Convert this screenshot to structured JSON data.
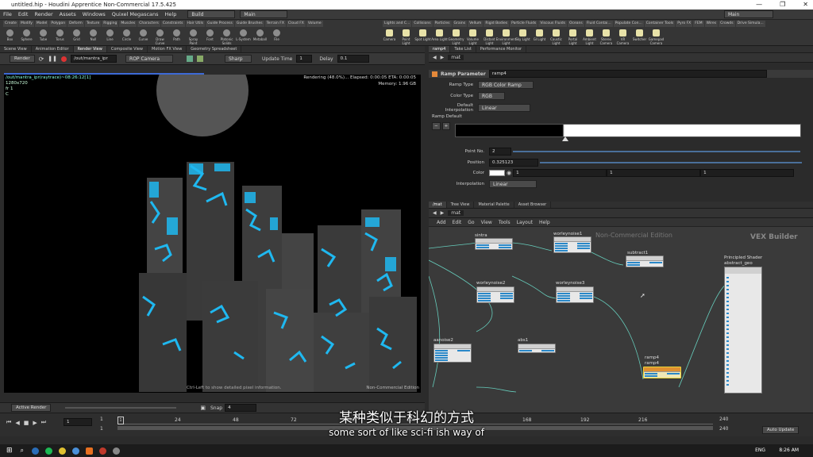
{
  "window": {
    "title": "untitled.hip - Houdini Apprentice Non-Commercial 17.5.425",
    "minimize": "—",
    "maximize": "❐",
    "close": "✕"
  },
  "menu": {
    "items": [
      "File",
      "Edit",
      "Render",
      "Assets",
      "Windows",
      "Quixel Megascans",
      "Help"
    ],
    "desktop": "Build",
    "layout": "Main",
    "right_desktop": "Main"
  },
  "shelf": {
    "tabs_left": [
      "Create",
      "Modify",
      "Model",
      "Polygon",
      "Deform",
      "Texture",
      "Rigging",
      "Muscles",
      "Characters",
      "Constraints",
      "Hair Utils",
      "Guide Process",
      "Guide Brushes",
      "Terrain FX",
      "Cloud FX",
      "Volume"
    ],
    "tabs_right": [
      "Lights and C...",
      "Collisions",
      "Particles",
      "Grains",
      "Vellum",
      "Rigid Bodies",
      "Particle Fluids",
      "Viscous Fluids",
      "Oceans",
      "Fluid Contai...",
      "Populate Con...",
      "Container Tools",
      "Pyro FX",
      "FEM",
      "Wires",
      "Crowds",
      "Drive Simula..."
    ],
    "tools_left": [
      "Box",
      "Sphere",
      "Tube",
      "Torus",
      "Grid",
      "Null",
      "Line",
      "Circle",
      "Curve",
      "Draw Curve",
      "Path",
      "Spray Paint",
      "Font",
      "Platonic Solids",
      "L-System",
      "Metaball",
      "File"
    ],
    "tools_right": [
      "Camera",
      "Point Light",
      "Spot Light",
      "Area Light",
      "Geometry Light",
      "Volume Light",
      "Distant Light",
      "Environment Light",
      "Sky Light",
      "GI Light",
      "Caustic Light",
      "Portal Light",
      "Ambient Light",
      "Stereo Camera",
      "VR Camera",
      "Switcher",
      "Gamepad Camera"
    ]
  },
  "left_tabs": [
    "Scene View",
    "Animation Editor",
    "Render View",
    "Composite View",
    "Motion FX View",
    "Geometry Spreadsheet"
  ],
  "render": {
    "render_btn": "Render",
    "path": "/out/mantra_ipr",
    "camera": "ROP Camera",
    "sharp": "Sharp",
    "update_label": "Update Time",
    "update_value": "1",
    "delay_label": "Delay",
    "delay_value": "0.1"
  },
  "viewport": {
    "path_info": "/out/mantra_ipr(raytrace)~08:26:12[1]",
    "res": "1280x720",
    "fr": "fr 1",
    "c": "C",
    "status": "Rendering (48.0%)... Elapsed: 0:00:05   ETA: 0:00:05",
    "memory": "Memory:        1.96 GB",
    "hint": "Ctrl-Left to show detailed pixel information.",
    "watermark": "Non-Commercial Edition",
    "progress": 0.48
  },
  "active_render": {
    "label": "Active Render",
    "snap_label": "Snap",
    "snap_value": "4"
  },
  "parm": {
    "tabs": [
      "ramp4",
      "Take List",
      "Performance Monitor"
    ],
    "path": "mat",
    "node_type": "Ramp Parameter",
    "node_name": "ramp4",
    "ramp_type_label": "Ramp Type",
    "ramp_type": "RGB Color Ramp",
    "color_type_label": "Color Type",
    "color_type": "RGB",
    "interp_label": "Default Interpolation",
    "interp": "Linear",
    "ramp_default": "Ramp Default",
    "point_label": "Point No.",
    "point": "2",
    "pos_label": "Position",
    "pos": "0.325123",
    "color_label": "Color",
    "c1": "1",
    "c2": "1",
    "c3": "1",
    "interp2_label": "Interpolation",
    "interp2": "Linear"
  },
  "network": {
    "tabs": [
      "/mat",
      "Tree View",
      "Material Palette",
      "Asset Browser"
    ],
    "path": "mat",
    "menu": [
      "Add",
      "Edit",
      "Go",
      "View",
      "Tools",
      "Layout",
      "Help"
    ],
    "watermark": "Non-Commercial Edition",
    "builder": "VEX Builder",
    "nodes": {
      "n1": "sintra",
      "n2": "worleynoise1",
      "n3": "subtract1",
      "n4": "worleynoise2",
      "n5": "worleynoise3",
      "n6": "aanoise2",
      "n7": "abs1",
      "n8a": "ramp4",
      "n8b": "ramp4",
      "n9a": "Principled Shader",
      "n9b": "abstract_geo"
    }
  },
  "timeline": {
    "frame": "1",
    "start": "1",
    "end": "1",
    "ticks": [
      "24",
      "48",
      "72",
      "96",
      "120",
      "144",
      "168",
      "192",
      "216"
    ],
    "end_a": "240",
    "end_b": "240"
  },
  "subtitles": {
    "zh": "某种类似于科幻的方式",
    "en": "some sort of like sci-fi ish way of"
  },
  "taskbar": {
    "lang": "ENG",
    "time": "8:26 AM",
    "update": "Auto Update"
  }
}
